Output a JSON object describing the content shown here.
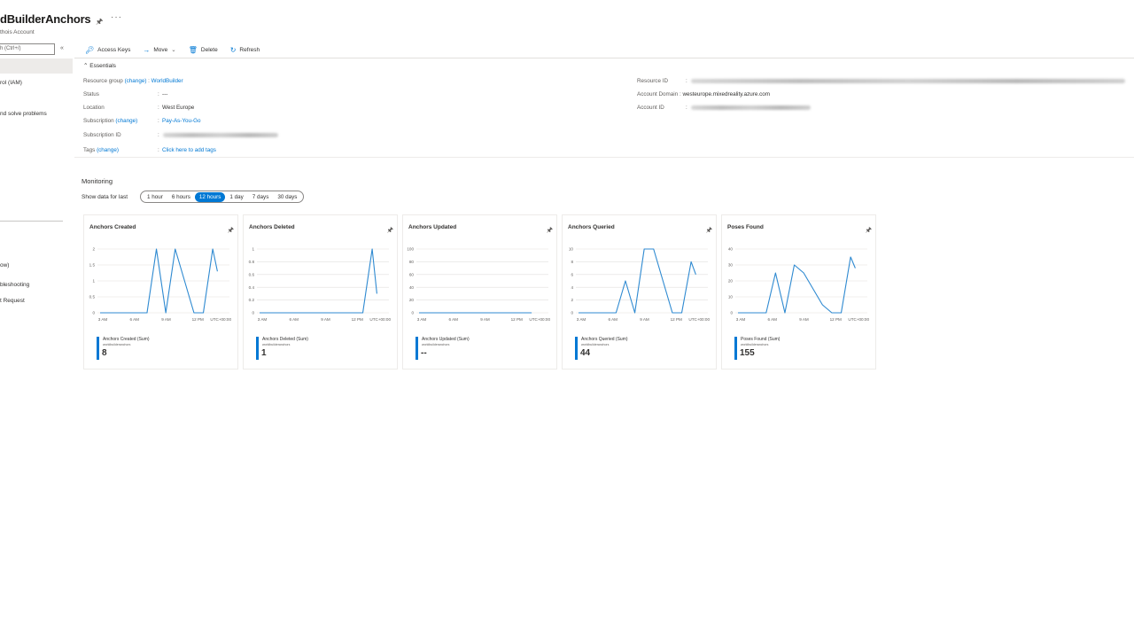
{
  "header": {
    "title": "dBuilderAnchors",
    "subtitle": "thois Account"
  },
  "sidebar": {
    "search_placeholder": "h (Ctrl+/)",
    "collapse_label": "«",
    "items": [
      "rol (IAM)",
      "nd solve problems",
      "ow)",
      "bleshooting",
      "t Request"
    ]
  },
  "toolbar": {
    "access_keys": "Access Keys",
    "move": "Move",
    "delete": "Delete",
    "refresh": "Refresh"
  },
  "essentials": {
    "header": "Essentials",
    "resource_group": {
      "label": "Resource group",
      "change": "(change)",
      "value": "WorldBuilder"
    },
    "status": {
      "label": "Status",
      "value": "---"
    },
    "location": {
      "label": "Location",
      "value": "West Europe"
    },
    "subscription": {
      "label": "Subscription",
      "change": "(change)",
      "value": "Pay-As-You-Go"
    },
    "subscription_id": {
      "label": "Subscription ID"
    },
    "tags": {
      "label": "Tags",
      "change": "(change)",
      "value": "Click here to add tags"
    },
    "resource_id": {
      "label": "Resource ID"
    },
    "account_domain": {
      "label": "Account Domain",
      "value": "westeurope.mixedreality.azure.com"
    },
    "account_id": {
      "label": "Account ID"
    }
  },
  "monitoring": {
    "title": "Monitoring",
    "show_label": "Show data for last",
    "ranges": [
      "1 hour",
      "6 hours",
      "12 hours",
      "1 day",
      "7 days",
      "30 days"
    ],
    "selected_range": "12 hours"
  },
  "colors": {
    "accent": "#0078d4",
    "line": "#2f8ad1"
  },
  "chart_data": [
    {
      "type": "line",
      "title": "Anchors Created",
      "x_ticks": [
        "3 AM",
        "6 AM",
        "9 AM",
        "12 PM",
        "UTC+00:00"
      ],
      "y_ticks": [
        "0",
        "0.5",
        "1",
        "1.5",
        "2"
      ],
      "ylim": [
        0,
        2
      ],
      "x": [
        0,
        1,
        2,
        3,
        4,
        5,
        6,
        7,
        8,
        9,
        10,
        11,
        12
      ],
      "values": [
        0,
        0,
        0,
        0,
        0,
        0,
        2,
        0,
        2,
        1,
        0,
        0,
        2
      ],
      "tail": 1.3,
      "legend": "Anchors Created (Sum)",
      "legend_sub": "worldbuilderanchors",
      "total": "8"
    },
    {
      "type": "line",
      "title": "Anchors Deleted",
      "x_ticks": [
        "3 AM",
        "6 AM",
        "9 AM",
        "12 PM",
        "UTC+00:00"
      ],
      "y_ticks": [
        "0",
        "0.2",
        "0.4",
        "0.6",
        "0.8",
        "1"
      ],
      "ylim": [
        0,
        1
      ],
      "x": [
        0,
        1,
        2,
        3,
        4,
        5,
        6,
        7,
        8,
        9,
        10,
        11,
        12
      ],
      "values": [
        0,
        0,
        0,
        0,
        0,
        0,
        0,
        0,
        0,
        0,
        0,
        0,
        1
      ],
      "tail": 0.3,
      "legend": "Anchors Deleted (Sum)",
      "legend_sub": "worldbuilderanchors",
      "total": "1"
    },
    {
      "type": "line",
      "title": "Anchors Updated",
      "x_ticks": [
        "3 AM",
        "6 AM",
        "9 AM",
        "12 PM",
        "UTC+00:00"
      ],
      "y_ticks": [
        "0",
        "20",
        "40",
        "60",
        "80",
        "100"
      ],
      "ylim": [
        0,
        100
      ],
      "x": [
        0,
        1,
        2,
        3,
        4,
        5,
        6,
        7,
        8,
        9,
        10,
        11,
        12
      ],
      "values": [
        0,
        0,
        0,
        0,
        0,
        0,
        0,
        0,
        0,
        0,
        0,
        0,
        0
      ],
      "tail": null,
      "legend": "Anchors Updated (Sum)",
      "legend_sub": "worldbuilderanchors",
      "total": "--"
    },
    {
      "type": "line",
      "title": "Anchors Queried",
      "x_ticks": [
        "3 AM",
        "6 AM",
        "9 AM",
        "12 PM",
        "UTC+00:00"
      ],
      "y_ticks": [
        "0",
        "2",
        "4",
        "6",
        "8",
        "10"
      ],
      "ylim": [
        0,
        10
      ],
      "x": [
        0,
        1,
        2,
        3,
        4,
        5,
        6,
        7,
        8,
        9,
        10,
        11,
        12
      ],
      "values": [
        0,
        0,
        0,
        0,
        0,
        5,
        0,
        10,
        10,
        5,
        0,
        0,
        8
      ],
      "tail": 6,
      "legend": "Anchors Queried (Sum)",
      "legend_sub": "worldbuilderanchors",
      "total": "44"
    },
    {
      "type": "line",
      "title": "Poses Found",
      "x_ticks": [
        "3 AM",
        "6 AM",
        "9 AM",
        "12 PM",
        "UTC+00:00"
      ],
      "y_ticks": [
        "0",
        "10",
        "20",
        "30",
        "40"
      ],
      "ylim": [
        0,
        40
      ],
      "x": [
        0,
        1,
        2,
        3,
        4,
        5,
        6,
        7,
        8,
        9,
        10,
        11,
        12
      ],
      "values": [
        0,
        0,
        0,
        0,
        25,
        0,
        30,
        25,
        15,
        5,
        0,
        0,
        35
      ],
      "tail": 28,
      "legend": "Poses Found (Sum)",
      "legend_sub": "worldbuilderanchors",
      "total": "155"
    }
  ]
}
